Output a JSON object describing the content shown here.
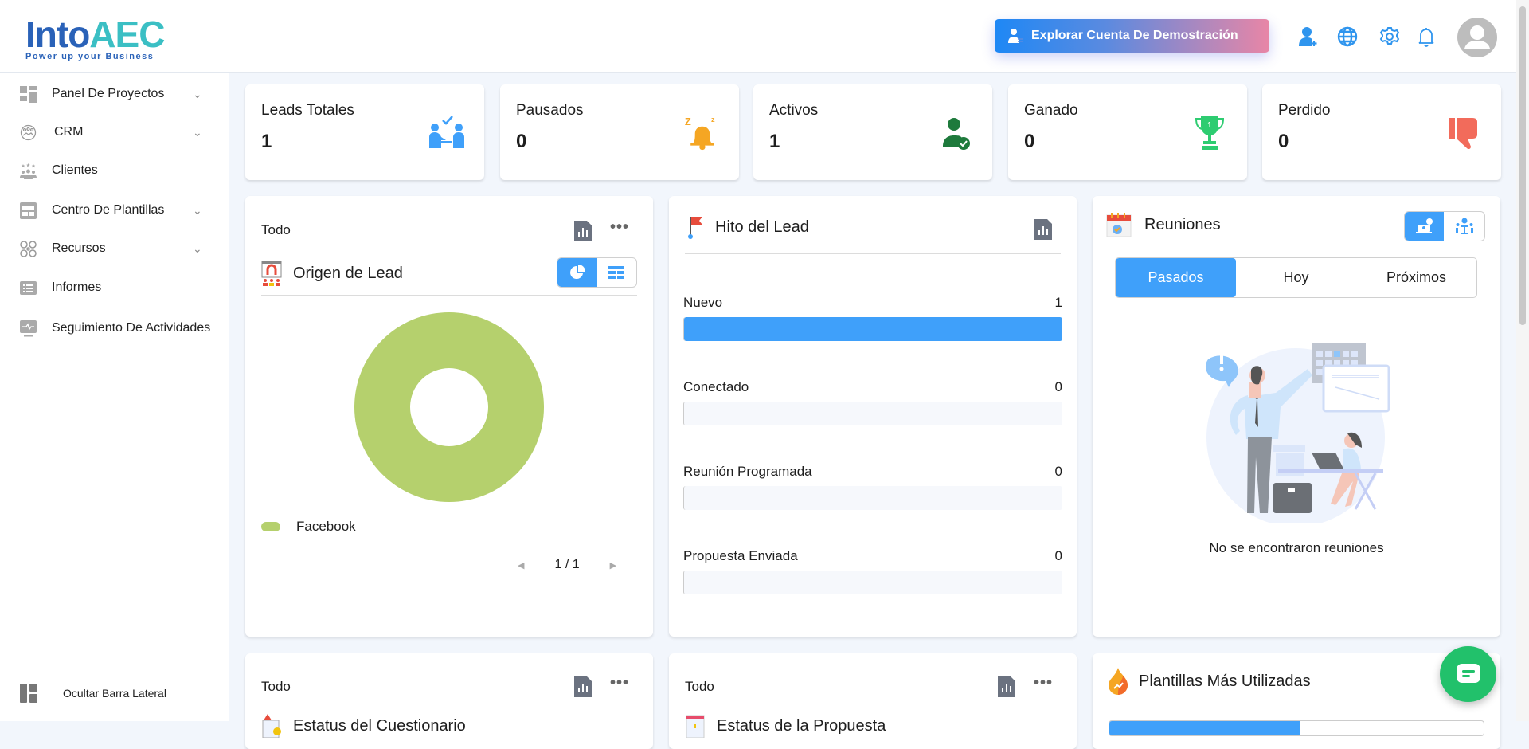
{
  "brand": {
    "name_a": "Into",
    "name_b": "AEC",
    "tagline": "Power up your Business"
  },
  "header": {
    "demo_button": "Explorar Cuenta De Demostración"
  },
  "sidebar": {
    "items": [
      {
        "label": "Panel De Proyectos",
        "expandable": true
      },
      {
        "label": "CRM",
        "expandable": true
      },
      {
        "label": "Clientes",
        "expandable": false
      },
      {
        "label": "Centro De Plantillas",
        "expandable": true
      },
      {
        "label": "Recursos",
        "expandable": true
      },
      {
        "label": "Informes",
        "expandable": false
      },
      {
        "label": "Seguimiento De Actividades",
        "expandable": false
      }
    ],
    "hide_label": "Ocultar Barra Lateral"
  },
  "stats": [
    {
      "label": "Leads Totales",
      "value": "1"
    },
    {
      "label": "Pausados",
      "value": "0"
    },
    {
      "label": "Activos",
      "value": "1"
    },
    {
      "label": "Ganado",
      "value": "0"
    },
    {
      "label": "Perdido",
      "value": "0"
    }
  ],
  "lead_source": {
    "filter": "Todo",
    "title": "Origen de Lead",
    "legend": [
      {
        "label": "Facebook",
        "color": "#b5d06d",
        "value": 1
      }
    ],
    "pagination": "1 / 1"
  },
  "chart_data": {
    "type": "pie",
    "title": "Origen de Lead",
    "categories": [
      "Facebook"
    ],
    "values": [
      1
    ],
    "colors": [
      "#b5d06d"
    ],
    "donut": true
  },
  "milestone": {
    "title": "Hito del Lead",
    "rows": [
      {
        "label": "Nuevo",
        "value": 1
      },
      {
        "label": "Conectado",
        "value": 0
      },
      {
        "label": "Reunión Programada",
        "value": 0
      },
      {
        "label": "Propuesta Enviada",
        "value": 0
      }
    ],
    "max": 1
  },
  "meetings": {
    "title": "Reuniones",
    "tabs": [
      "Pasados",
      "Hoy",
      "Próximos"
    ],
    "active_tab": 0,
    "empty": "No se encontraron reuniones"
  },
  "bottom": {
    "card1_filter": "Todo",
    "card1_title": "Estatus del Cuestionario",
    "card2_filter": "Todo",
    "card2_title": "Estatus de la Propuesta",
    "card3_title": "Plantillas Más Utilizadas"
  }
}
